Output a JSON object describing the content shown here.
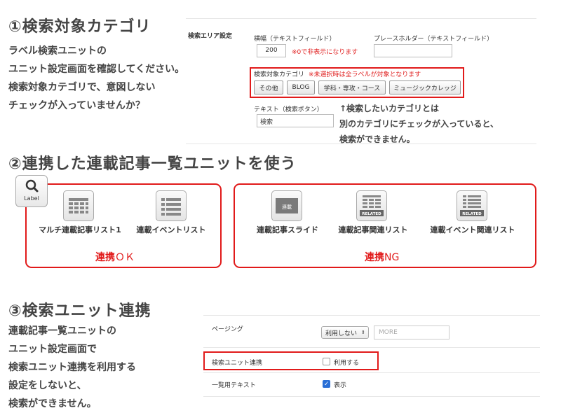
{
  "section1": {
    "heading": "①検索対象カテゴリ",
    "description": "ラベル検索ユニットの\nユニット設定画面を確認してください。\n検索対象カテゴリで、意図しない\nチェックが入っていませんか？",
    "panel": {
      "area_label": "検索エリア設定",
      "width_label": "横幅（テキストフィールド）",
      "width_value": "200",
      "width_note": "※0で非表示になります",
      "placeholder_label": "プレースホルダー（テキストフィールド）",
      "placeholder_value": "",
      "category_label": "検索対象カテゴリ",
      "category_note": "※未選択時は全ラベルが対象となります",
      "categories": [
        "その他",
        "BLOG",
        "学科・専攻・コース",
        "ミュージックカレッジ"
      ],
      "text_label": "テキスト（検索ボタン）",
      "text_value": "検索"
    },
    "arrow_note": "↑検索したいカテゴリとは\n別のカテゴリにチェックが入っていると、\n検索ができません。"
  },
  "section2": {
    "heading": "②連携した連載記事一覧ユニットを使う",
    "search_tile_label": "Label",
    "ok_units": [
      {
        "label": "マルチ連載記事リスト1",
        "icon": "grid-list-icon"
      },
      {
        "label": "連載イベントリスト",
        "icon": "bullet-list-icon"
      }
    ],
    "ok_result_bold": "連携",
    "ok_result_rest": "ＯＫ",
    "ng_units": [
      {
        "label": "連載記事スライド",
        "icon": "slide-icon",
        "icon_text": "連載"
      },
      {
        "label": "連載記事関連リスト",
        "icon": "related-grid-icon",
        "icon_text": "RELATED"
      },
      {
        "label": "連載イベント関連リスト",
        "icon": "related-list-icon",
        "icon_text": "RELATED"
      }
    ],
    "ng_result_bold": "連携",
    "ng_result_rest": "NG"
  },
  "section3": {
    "heading": "③検索ユニット連携",
    "description": "連載記事一覧ユニットの\nユニット設定画面で\n検索ユニット連携を利用する\n設定をしないと、\n検索ができません。",
    "panel": {
      "paging_label": "ページング",
      "paging_select": "利用しない",
      "paging_more": "MORE",
      "search_link_label": "検索ユニット連携",
      "search_link_option": "利用する",
      "search_link_checked": false,
      "list_text_label": "一覧用テキスト",
      "list_text_option": "表示",
      "list_text_checked": true
    }
  },
  "colors": {
    "accent_red": "#e11a1a",
    "text": "#444444",
    "checkbox_blue": "#2a6fd6"
  }
}
